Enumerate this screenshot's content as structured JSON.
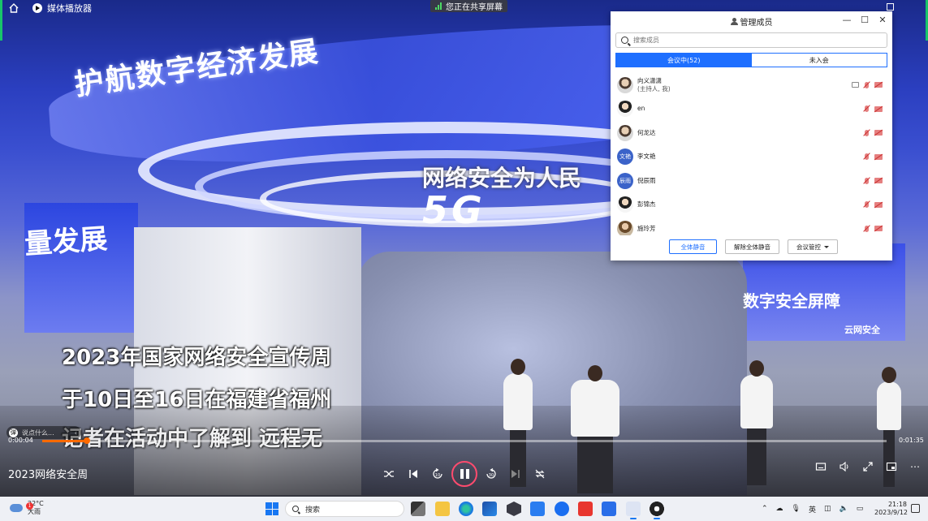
{
  "topbar": {
    "app_title": "媒体播放器",
    "share_status": "您正在共享屏幕"
  },
  "scene": {
    "banner_text": "护航数字经济发展",
    "left_text": "量发展",
    "ring_text": "网络安全为人民",
    "ring_5g": "5G",
    "right_text": "数字安全屏障",
    "right_small": "云网安全"
  },
  "subtitles": [
    "2023年国家网络安全宣传周",
    "于10日至16日在福建省福州",
    "记者在活动中了解到 远程无"
  ],
  "members_panel": {
    "title": "管理成员",
    "search_placeholder": "搜索成员",
    "tabs": [
      {
        "label": "会议中(52)",
        "active": true
      },
      {
        "label": "未入会",
        "active": false
      }
    ],
    "members": [
      {
        "name": "向义潇潇",
        "sub": "(主持人, 我)",
        "avatar": "photo",
        "avatar_text": "",
        "screen": true
      },
      {
        "name": "en",
        "sub": "",
        "avatar": "dark",
        "avatar_text": "",
        "screen": false
      },
      {
        "name": "何龙达",
        "sub": "",
        "avatar": "photo",
        "avatar_text": "",
        "screen": false
      },
      {
        "name": "李文艳",
        "sub": "",
        "avatar": "text",
        "avatar_text": "文艳",
        "screen": false
      },
      {
        "name": "倪辰雨",
        "sub": "",
        "avatar": "text",
        "avatar_text": "辰雨",
        "screen": false
      },
      {
        "name": "彭锦杰",
        "sub": "",
        "avatar": "dark",
        "avatar_text": "",
        "screen": false
      },
      {
        "name": "施玲芳",
        "sub": "",
        "avatar": "brown",
        "avatar_text": "",
        "screen": false
      }
    ],
    "actions": {
      "mute_all": "全体静音",
      "unmute_all": "解除全体静音",
      "manage": "会议管控"
    }
  },
  "player": {
    "danmaku_placeholder": "说点什么...",
    "current_time": "0:00:04",
    "total_time": "0:01:35",
    "progress": 0.053,
    "video_title": "2023网络安全周"
  },
  "taskbar": {
    "weather_temp": "22°C",
    "weather_desc": "大雨",
    "weather_badge": "1",
    "search_label": "搜索",
    "ime": "英",
    "time": "21:18",
    "date": "2023/9/12"
  }
}
